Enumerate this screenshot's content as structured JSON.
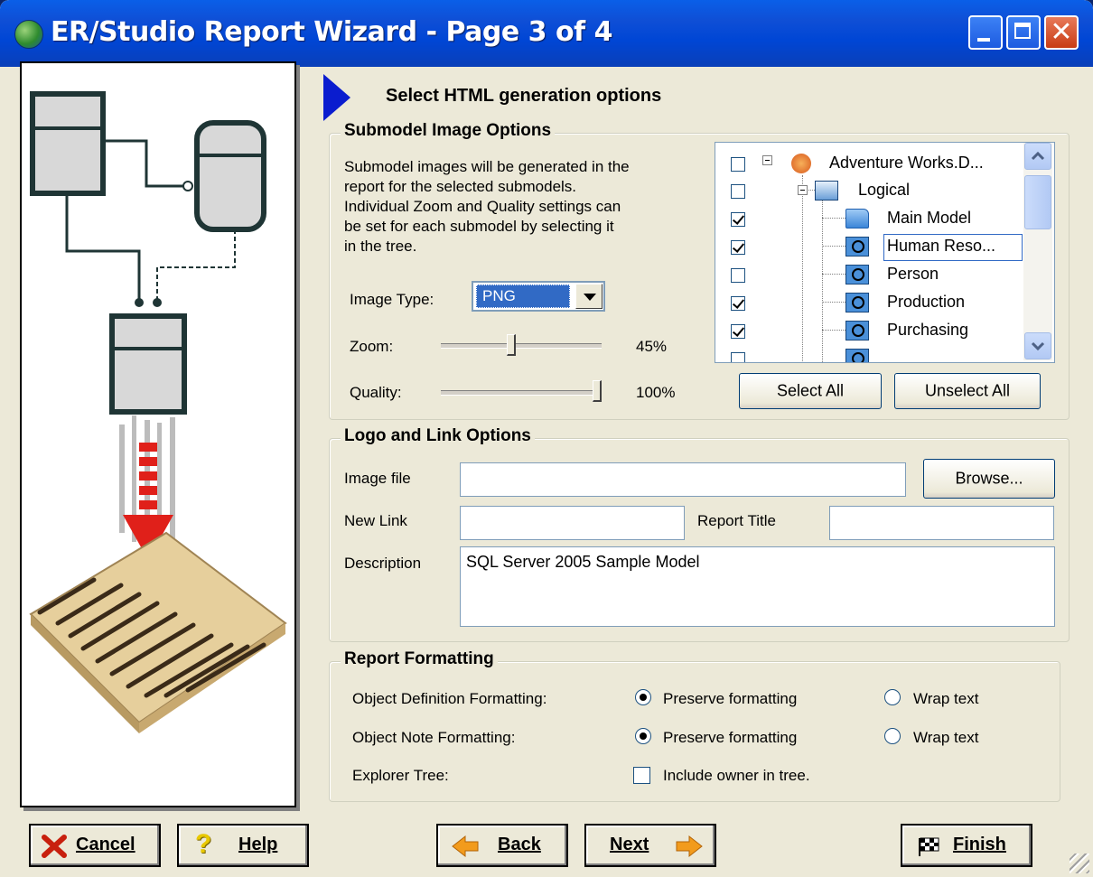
{
  "window": {
    "title": "ER/Studio Report Wizard - Page 3 of 4"
  },
  "header": {
    "text": "Select HTML generation options"
  },
  "submodel_image_options": {
    "legend": "Submodel Image Options",
    "description_lines": [
      "Submodel images will be generated in the",
      "report for the selected submodels.",
      "Individual Zoom and Quality settings can",
      "be set for each submodel  by selecting it",
      "in the tree."
    ],
    "image_type_label": "Image Type:",
    "image_type_value": "PNG",
    "zoom_label": "Zoom:",
    "zoom_value": "45%",
    "zoom_fraction": 0.45,
    "quality_label": "Quality:",
    "quality_value": "100%",
    "quality_fraction": 1.0,
    "tree": [
      {
        "label": "Adventure Works.D...",
        "checked": false,
        "icon": "model-icon"
      },
      {
        "label": "Logical",
        "checked": false,
        "icon": "logical-icon"
      },
      {
        "label": "Main Model",
        "checked": true,
        "icon": "folder-icon"
      },
      {
        "label": "Human Reso...",
        "checked": true,
        "icon": "submodel-icon",
        "selected": true
      },
      {
        "label": "Person",
        "checked": false,
        "icon": "submodel-icon"
      },
      {
        "label": "Production",
        "checked": true,
        "icon": "submodel-icon"
      },
      {
        "label": "Purchasing",
        "checked": true,
        "icon": "submodel-icon"
      }
    ],
    "select_all": "Select All",
    "unselect_all": "Unselect All"
  },
  "logo_link_options": {
    "legend": "Logo and Link Options",
    "image_file_label": "Image file",
    "image_file_value": "",
    "browse": "Browse...",
    "new_link_label": "New Link",
    "new_link_value": "",
    "report_title_label": "Report Title",
    "report_title_value": "",
    "description_label": "Description",
    "description_value": "SQL Server 2005 Sample Model"
  },
  "report_formatting": {
    "legend": "Report Formatting",
    "object_definition_label": "Object Definition Formatting:",
    "object_note_label": "Object Note Formatting:",
    "explorer_tree_label": "Explorer Tree:",
    "preserve_formatting": "Preserve formatting",
    "wrap_text": "Wrap text",
    "include_owner": "Include owner in tree.",
    "object_definition_choice": "Preserve formatting",
    "object_note_choice": "Preserve formatting",
    "include_owner_checked": false
  },
  "footer": {
    "cancel": "Cancel",
    "help": "Help",
    "back": "Back",
    "next": "Next",
    "finish": "Finish"
  },
  "colors": {
    "titlebar": "#0046d5",
    "dialog": "#ece9d8",
    "header_arrow": "#0a1ccf",
    "selection": "#316ac5"
  }
}
